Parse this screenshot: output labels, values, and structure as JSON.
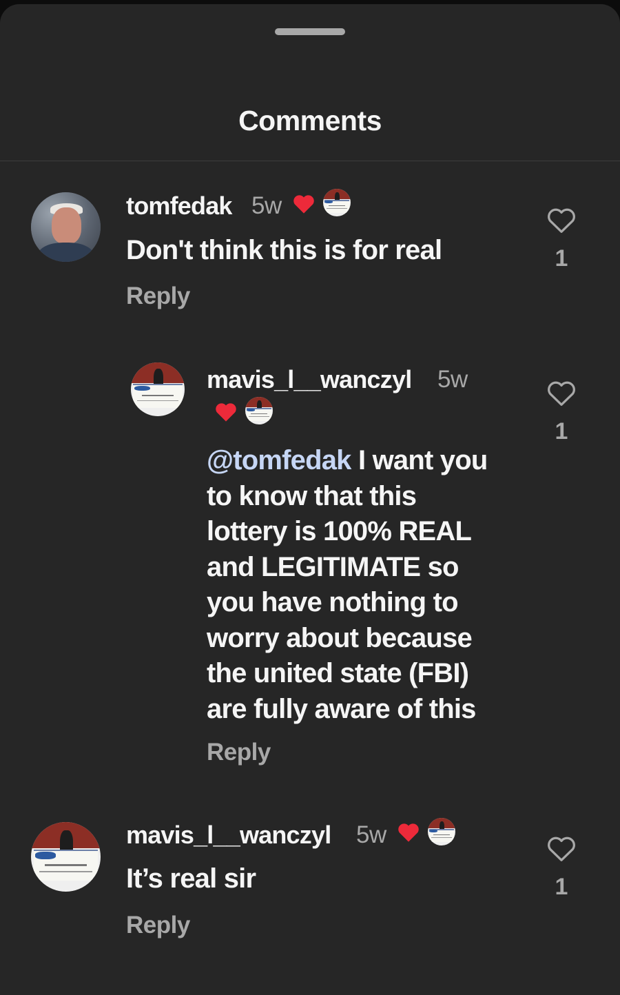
{
  "header": {
    "title": "Comments"
  },
  "comments": [
    {
      "username": "tomfedak",
      "time": "5w",
      "text": "Don't think this is for real",
      "reply_label": "Reply",
      "likes": "1"
    },
    {
      "username": "mavis_l__wanczyl",
      "time": "5w",
      "mention": "@tomfedak",
      "text": " I want you to know that this lottery is 100% REAL and LEGITIMATE so you have nothing to worry about because the united state (FBI) are fully aware of this",
      "reply_label": "Reply",
      "likes": "1"
    },
    {
      "username": "mavis_l__wanczyl",
      "time": "5w",
      "text": "It’s real sir",
      "reply_label": "Reply",
      "likes": "1"
    }
  ],
  "colors": {
    "background": "#262626",
    "like_heart": "#ed2a3a",
    "mention": "#c6d6f5",
    "secondary_text": "#a8a8a8"
  },
  "icons": {
    "creator_like": "red-heart-icon",
    "like_button": "heart-outline-icon"
  }
}
